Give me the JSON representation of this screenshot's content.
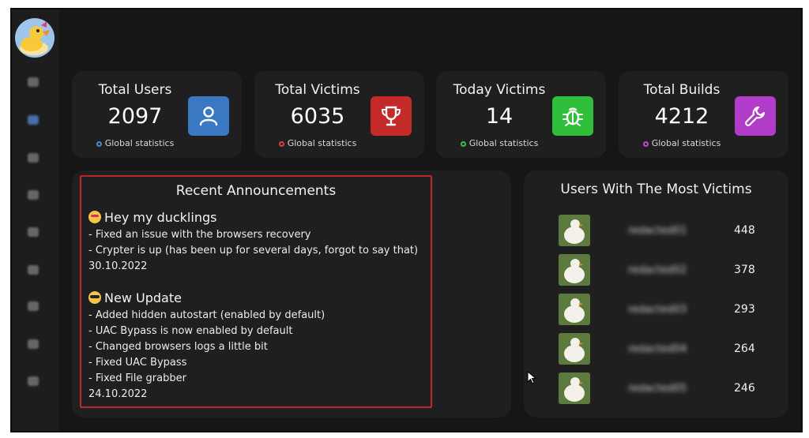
{
  "cards": [
    {
      "title": "Total Users",
      "value": "2097",
      "sub": "Global statistics",
      "color": "#3a78c4",
      "dot_color": "#3a8fd8",
      "icon": "user-icon"
    },
    {
      "title": "Total Victims",
      "value": "6035",
      "sub": "Global statistics",
      "color": "#c42a2a",
      "dot_color": "#e03b3b",
      "icon": "trophy-icon"
    },
    {
      "title": "Today Victims",
      "value": "14",
      "sub": "Global statistics",
      "color": "#2fbf3b",
      "dot_color": "#33c544",
      "icon": "bug-icon"
    },
    {
      "title": "Total Builds",
      "value": "4212",
      "sub": "Global statistics",
      "color": "#b13cc8",
      "dot_color": "#c447d9",
      "icon": "wrench-icon"
    }
  ],
  "announcements": {
    "title": "Recent Announcements",
    "posts": [
      {
        "heading": "Hey my ducklings",
        "emoji": "smiling-hearts-emoji",
        "lines": [
          "- Fixed an issue with the browsers recovery",
          "- Crypter is up (has been up for several days, forgot to say that)"
        ],
        "date": "30.10.2022"
      },
      {
        "heading": "New Update",
        "emoji": "sunglasses-emoji",
        "lines": [
          "- Added hidden autostart (enabled by default)",
          "- UAC Bypass is now enabled by default",
          "- Changed browsers logs a little bit",
          "- Fixed UAC Bypass",
          "- Fixed File grabber"
        ],
        "date": "24.10.2022"
      }
    ]
  },
  "top_users": {
    "title": "Users With The Most Victims",
    "rows": [
      {
        "name": "redacted01",
        "count": "448"
      },
      {
        "name": "redacted02",
        "count": "378"
      },
      {
        "name": "redacted03",
        "count": "293"
      },
      {
        "name": "redacted04",
        "count": "264"
      },
      {
        "name": "redacted05",
        "count": "246"
      }
    ]
  },
  "sidebar": {
    "items": [
      "nav-icon-1",
      "nav-icon-2",
      "nav-icon-3",
      "nav-icon-4",
      "nav-icon-5",
      "nav-icon-6",
      "nav-icon-7",
      "nav-icon-8",
      "nav-icon-9"
    ]
  }
}
